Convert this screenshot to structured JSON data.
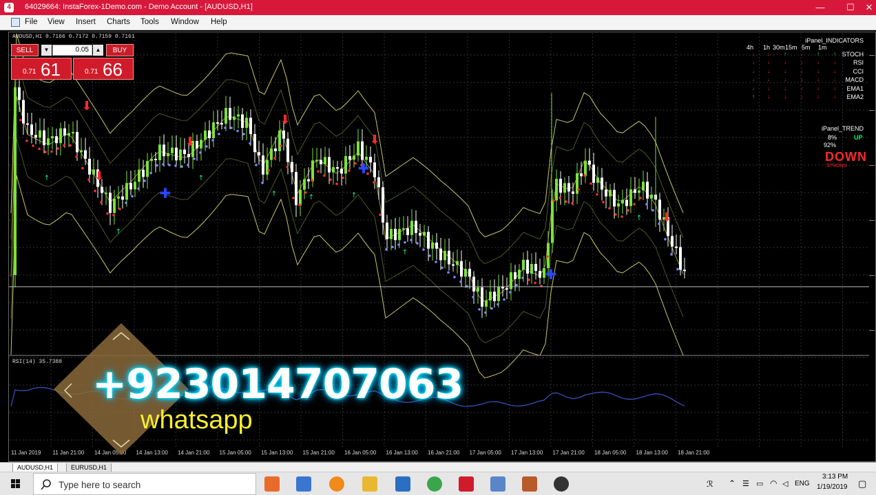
{
  "window": {
    "title": "64029664: InstaForex-1Demo.com - Demo Account - [AUDUSD,H1]",
    "app_icon": "4",
    "minimize": "—",
    "maximize": "☐",
    "close": "✕"
  },
  "menu": [
    "File",
    "View",
    "Insert",
    "Charts",
    "Tools",
    "Window",
    "Help"
  ],
  "chart": {
    "symbol_line": "AUDUSD,H1  0.7166 0.7172 0.7159 0.7161",
    "rsi_label": "RSI(14) 35.7388"
  },
  "trade_panel": {
    "sell_label": "SELL",
    "buy_label": "BUY",
    "lot_down": "▼",
    "lot_up": "▲",
    "lot_value": "0.05",
    "sell_small": "0.71",
    "sell_big": "61",
    "buy_small": "0.71",
    "buy_big": "66"
  },
  "ipanel": {
    "title": "iPanel_INDICATORS",
    "timeframes": [
      "4h",
      "1h",
      "30m",
      "15m",
      "5m",
      "1m"
    ],
    "indicators": [
      {
        "name": "STOCH",
        "signals": [
          "down",
          "down",
          "up",
          "down",
          "up",
          "up"
        ]
      },
      {
        "name": "RSI",
        "signals": [
          "down",
          "down",
          "down",
          "down",
          "down",
          "down"
        ]
      },
      {
        "name": "CCI",
        "signals": [
          "down",
          "down",
          "down",
          "down",
          "down",
          "down"
        ]
      },
      {
        "name": "MACD",
        "signals": [
          "down",
          "down",
          "down",
          "down",
          "down",
          "down"
        ]
      },
      {
        "name": "EMA1",
        "signals": [
          "down",
          "down",
          "down",
          "down",
          "down",
          "down"
        ]
      },
      {
        "name": "EMA2",
        "signals": [
          "up",
          "down",
          "down",
          "down",
          "down",
          "down"
        ]
      }
    ],
    "up_glyph": "↑",
    "down_glyph": "↓",
    "up_color": "#00ff66",
    "down_color": "#ff2222"
  },
  "trend_panel": {
    "title": "iPanel_TREND",
    "up_pct": "8%",
    "up_word": "UP",
    "down_pct": "92%",
    "down_word": "DOWN",
    "strength": "STRONG"
  },
  "time_axis": [
    "11 Jan 2019",
    "11 Jan 21:00",
    "14 Jan 05:00",
    "14 Jan 13:00",
    "14 Jan 21:00",
    "15 Jan 05:00",
    "15 Jan 13:00",
    "15 Jan 21:00",
    "16 Jan 05:00",
    "16 Jan 13:00",
    "16 Jan 21:00",
    "17 Jan 05:00",
    "17 Jan 13:00",
    "17 Jan 21:00",
    "18 Jan 05:00",
    "18 Jan 13:00",
    "18 Jan 21:00"
  ],
  "tabs": [
    "AUDUSD,H1",
    "EURUSD,H1"
  ],
  "taskbar": {
    "search_placeholder": "Type here to search",
    "language": "ENG",
    "time": "3:13 PM",
    "date": "1/19/2019"
  },
  "overlay": {
    "phone": "+923014707063",
    "word": "whatsapp"
  },
  "colors": {
    "titlebar": "#d8183a",
    "bull_candle": "#7be23a",
    "bear_candle": "#ffffff",
    "band": "#c8c86a",
    "rsi_line": "#3b4fb8"
  }
}
